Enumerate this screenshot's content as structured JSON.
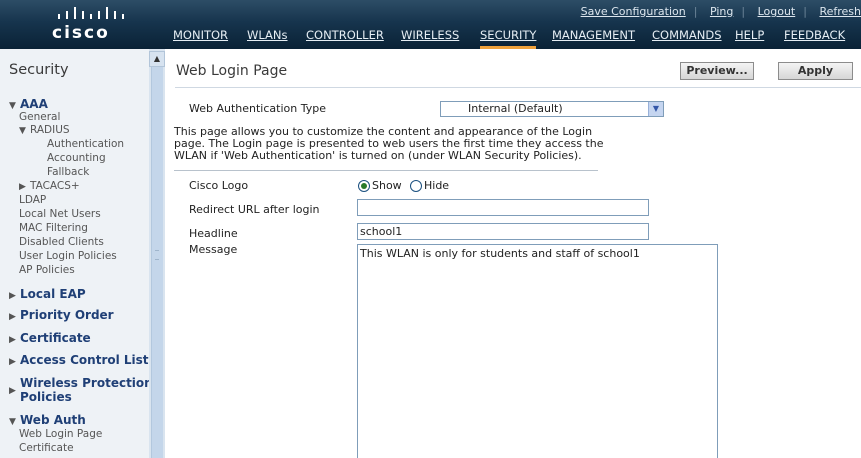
{
  "header": {
    "logo_text": "cisco",
    "utility_links": [
      "Save Configuration",
      "Ping",
      "Logout",
      "Refresh"
    ],
    "nav": [
      "MONITOR",
      "WLANs",
      "CONTROLLER",
      "WIRELESS",
      "SECURITY",
      "MANAGEMENT",
      "COMMANDS",
      "HELP",
      "FEEDBACK"
    ],
    "active_nav": "SECURITY",
    "accent_color": "#f0a23c"
  },
  "sidebar": {
    "title": "Security",
    "aaa": {
      "label": "AAA",
      "general": "General",
      "radius": "RADIUS",
      "radius_items": [
        "Authentication",
        "Accounting",
        "Fallback"
      ],
      "tacacs": "TACACS+",
      "items": [
        "LDAP",
        "Local Net Users",
        "MAC Filtering",
        "Disabled Clients",
        "User Login Policies",
        "AP Policies"
      ]
    },
    "sections": [
      "Local EAP",
      "Priority Order",
      "Certificate",
      "Access Control Lists"
    ],
    "wireless_protection": [
      "Wireless Protection",
      "Policies"
    ],
    "web_auth": {
      "label": "Web Auth",
      "items": [
        "Web Login Page",
        "Certificate"
      ]
    }
  },
  "main": {
    "title": "Web Login Page",
    "preview_button": "Preview...",
    "apply_button": "Apply",
    "web_auth_type_label": "Web Authentication Type",
    "web_auth_type_value": "Internal (Default)",
    "description": "This page allows you to customize the content and appearance of the Login page. The Login page is presented to web users the first time they access the WLAN if 'Web Authentication' is turned on (under WLAN Security Policies).",
    "cisco_logo_label": "Cisco Logo",
    "cisco_logo_options": [
      "Show",
      "Hide"
    ],
    "cisco_logo_selected": "Show",
    "redirect_label": "Redirect URL after login",
    "redirect_value": "",
    "headline_label": "Headline",
    "headline_value": "school1",
    "message_label": "Message",
    "message_value": "This  WLAN is only for students and staff of school1"
  }
}
